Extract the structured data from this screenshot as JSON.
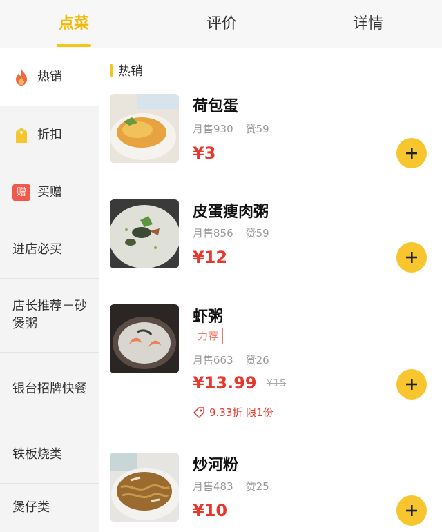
{
  "tabs": [
    {
      "label": "点菜",
      "active": true
    },
    {
      "label": "评价",
      "active": false
    },
    {
      "label": "详情",
      "active": false
    }
  ],
  "sidebar": {
    "items": [
      {
        "label": "热销",
        "icon": "flame-icon",
        "active": true
      },
      {
        "label": "折扣",
        "icon": "price-tag-icon",
        "active": false
      },
      {
        "label": "买赠",
        "icon": "gift-badge-icon",
        "badge": "赠",
        "active": false
      },
      {
        "label": "进店必买",
        "active": false
      },
      {
        "label": "店长推荐－砂煲粥",
        "active": false
      },
      {
        "label": "银台招牌快餐",
        "active": false
      },
      {
        "label": "铁板烧类",
        "active": false
      },
      {
        "label": "煲仔类",
        "active": false
      }
    ]
  },
  "section": {
    "title": "热销"
  },
  "dishes": [
    {
      "name": "荷包蛋",
      "sales": "月售930",
      "likes": "赞59",
      "price": "¥3"
    },
    {
      "name": "皮蛋瘦肉粥",
      "sales": "月售856",
      "likes": "赞59",
      "price": "¥12"
    },
    {
      "name": "虾粥",
      "tag": "力荐",
      "sales": "月售663",
      "likes": "赞26",
      "price": "¥13.99",
      "original_price": "¥15",
      "discount": "9.33折 限1份"
    },
    {
      "name": "炒河粉",
      "sales": "月售483",
      "likes": "赞25",
      "price": "¥10"
    }
  ],
  "colors": {
    "accent": "#f5c518",
    "price": "#e8382e",
    "add_button": "#f7c62f"
  }
}
